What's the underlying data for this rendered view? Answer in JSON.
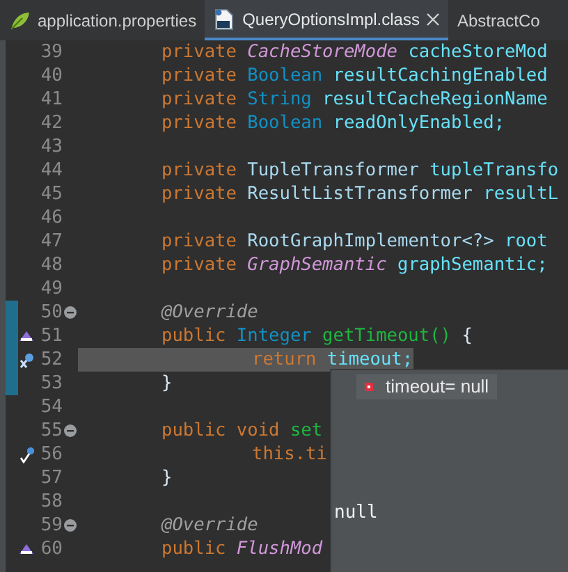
{
  "tabs": [
    {
      "label": "application.properties",
      "selected": false
    },
    {
      "label": "QueryOptionsImpl.class",
      "selected": true,
      "closable": true
    },
    {
      "label": "AbstractCo",
      "selected": false
    }
  ],
  "lines": [
    {
      "number": "39",
      "kind": "member",
      "tokens": [
        {
          "text": "private",
          "kind": "keyword"
        },
        {
          "text": "CacheStoreMode",
          "kind": "enum"
        },
        {
          "text": "cacheStoreMod",
          "kind": "field"
        }
      ]
    },
    {
      "number": "40",
      "kind": "member",
      "tokens": [
        {
          "text": "private",
          "kind": "keyword"
        },
        {
          "text": "Boolean",
          "kind": "type"
        },
        {
          "text": "resultCachingEnabled",
          "kind": "field"
        }
      ]
    },
    {
      "number": "41",
      "kind": "member",
      "tokens": [
        {
          "text": "private",
          "kind": "keyword"
        },
        {
          "text": "String",
          "kind": "type"
        },
        {
          "text": "resultCacheRegionName",
          "kind": "field"
        }
      ]
    },
    {
      "number": "42",
      "kind": "member",
      "tokens": [
        {
          "text": "private",
          "kind": "keyword"
        },
        {
          "text": "Boolean",
          "kind": "type"
        },
        {
          "text": "readOnlyEnabled;",
          "kind": "field"
        }
      ]
    },
    {
      "number": "43"
    },
    {
      "number": "44",
      "kind": "member",
      "tokens": [
        {
          "text": "private",
          "kind": "keyword"
        },
        {
          "text": "TupleTransformer",
          "kind": "class"
        },
        {
          "text": "tupleTransfo",
          "kind": "field"
        }
      ]
    },
    {
      "number": "45",
      "kind": "member",
      "tokens": [
        {
          "text": "private",
          "kind": "keyword"
        },
        {
          "text": "ResultListTransformer",
          "kind": "class"
        },
        {
          "text": "resultL",
          "kind": "field"
        }
      ]
    },
    {
      "number": "46"
    },
    {
      "number": "47",
      "kind": "member",
      "tokens": [
        {
          "text": "private",
          "kind": "keyword"
        },
        {
          "text": "RootGraphImplementor<?>",
          "kind": "class"
        },
        {
          "text": "root",
          "kind": "field"
        }
      ]
    },
    {
      "number": "48",
      "kind": "member",
      "tokens": [
        {
          "text": "private",
          "kind": "keyword"
        },
        {
          "text": "GraphSemantic",
          "kind": "enum"
        },
        {
          "text": "graphSemantic;",
          "kind": "field"
        }
      ]
    },
    {
      "number": "49"
    },
    {
      "number": "50",
      "kind": "member",
      "fold": true,
      "changed": true,
      "tokens": [
        {
          "text": "@Override",
          "kind": "annotation"
        }
      ]
    },
    {
      "number": "51",
      "kind": "member",
      "changed": true,
      "gutter_marker": {
        "kind": "override"
      },
      "tokens": [
        {
          "text": "public",
          "kind": "keyword"
        },
        {
          "text": "Integer",
          "kind": "type"
        },
        {
          "text": "getTimeout()",
          "kind": "method"
        },
        {
          "text": "{",
          "kind": "punct"
        }
      ]
    },
    {
      "number": "52",
      "kind": "statement",
      "changed": true,
      "current": true,
      "gutter_marker": {
        "kind": "debug"
      },
      "tokens": [
        {
          "text": "return",
          "kind": "keyword"
        },
        {
          "text": "timeout;",
          "kind": "field"
        }
      ]
    },
    {
      "number": "53",
      "kind": "member",
      "changed": true,
      "tokens": [
        {
          "text": "}",
          "kind": "punct"
        }
      ]
    },
    {
      "number": "54"
    },
    {
      "number": "55",
      "kind": "member",
      "fold": true,
      "tokens": [
        {
          "text": "public",
          "kind": "keyword"
        },
        {
          "text": "void",
          "kind": "keyword"
        },
        {
          "text": "set",
          "kind": "method"
        }
      ]
    },
    {
      "number": "56",
      "kind": "statement",
      "gutter_marker": {
        "kind": "breakpoint"
      },
      "tokens": [
        {
          "text": "this.ti",
          "kind": "keyword"
        }
      ]
    },
    {
      "number": "57",
      "kind": "member",
      "tokens": [
        {
          "text": "}",
          "kind": "punct"
        }
      ]
    },
    {
      "number": "58"
    },
    {
      "number": "59",
      "kind": "member",
      "fold": true,
      "tokens": [
        {
          "text": "@Override",
          "kind": "annotation"
        }
      ]
    },
    {
      "number": "60",
      "kind": "member",
      "gutter_marker": {
        "kind": "override"
      },
      "tokens": [
        {
          "text": "public",
          "kind": "keyword"
        },
        {
          "text": "FlushMod",
          "kind": "enum"
        }
      ]
    }
  ],
  "hover_popup": {
    "variable": "timeout= null",
    "value": "null"
  }
}
